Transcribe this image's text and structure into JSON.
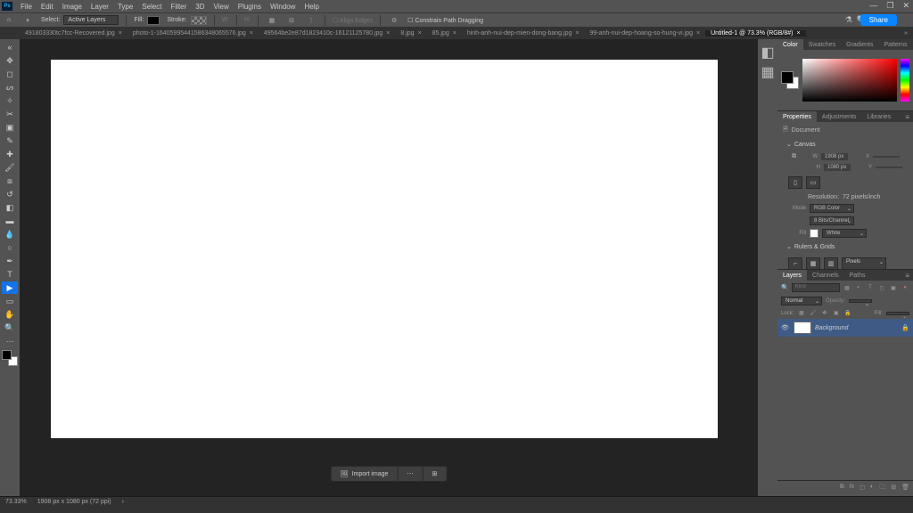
{
  "menu": {
    "items": [
      "File",
      "Edit",
      "Image",
      "Layer",
      "Type",
      "Select",
      "Filter",
      "3D",
      "View",
      "Plugins",
      "Window",
      "Help"
    ]
  },
  "optbar": {
    "select_label": "Select:",
    "select_value": "Active Layers",
    "fill_label": "Fill:",
    "stroke_label": "Stroke:",
    "align_edges": "Align Edges",
    "constrain": "Constrain Path Dragging",
    "share": "Share"
  },
  "tabs": [
    {
      "label": "491803330tc7fcc-Recovered.jpg"
    },
    {
      "label": "photo-1-16405995441586348065576.jpg"
    },
    {
      "label": "49564be2e87d1823410c-16121125780.jpg"
    },
    {
      "label": "8.jpg"
    },
    {
      "label": "85.jpg"
    },
    {
      "label": "hinh-anh-nui-dep-mien-dong-bang.jpg"
    },
    {
      "label": "99-anh-nui-dep-hoang-so-hung-vi.jpg"
    },
    {
      "label": "Untitled-1 @ 73.3% (RGB/8#)",
      "active": true
    }
  ],
  "panels": {
    "color": {
      "tabs": [
        "Color",
        "Swatches",
        "Gradients",
        "Patterns"
      ]
    },
    "properties": {
      "tabs": [
        "Properties",
        "Adjustments",
        "Libraries"
      ],
      "doc_label": "Document",
      "canvas_label": "Canvas",
      "w_label": "W",
      "w_value": "1908 px",
      "x_label": "X",
      "x_value": "",
      "h_label": "H",
      "h_value": "1080 px",
      "y_label": "Y",
      "y_value": "",
      "resolution_label": "Resolution:",
      "resolution_value": "72 pixels/inch",
      "mode_label": "Mode",
      "mode_value": "RGB Color",
      "bits": "8 Bits/Channel",
      "fill_label": "Fill",
      "fill_value": "White",
      "rulers_label": "Rulers & Grids",
      "rulers_unit": "Pixels"
    },
    "layers": {
      "tabs": [
        "Layers",
        "Channels",
        "Paths"
      ],
      "search_placeholder": "Kind",
      "blend": "Normal",
      "opacity_label": "Opacity:",
      "opacity": "",
      "lock_label": "Lock:",
      "fill_label": "Fill:",
      "fill": "",
      "layer_name": "Background"
    }
  },
  "import_label": "Import image",
  "status": {
    "zoom": "73.33%",
    "dims": "1908 px x 1080 px (72 ppi)"
  }
}
